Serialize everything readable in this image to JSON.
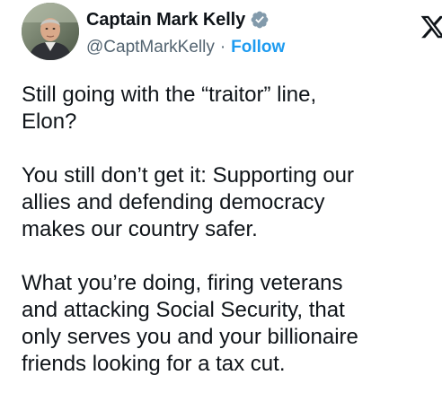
{
  "author": {
    "display_name": "Captain Mark Kelly",
    "handle": "@CaptMarkKelly",
    "separator": "·",
    "follow_label": "Follow",
    "verified": true,
    "avatar_icon": "profile-photo"
  },
  "platform": {
    "logo_icon": "x-logo-icon"
  },
  "tweet": {
    "paragraphs": [
      "Still going with the “traitor” line,\nElon?",
      "You still don’t get it: Supporting our\nallies and defending democracy\nmakes our country safer.",
      "What you’re doing, firing veterans\nand attacking Social Security, that\nonly serves you and your billionaire\nfriends looking for a tax cut."
    ]
  },
  "colors": {
    "text": "#0f1419",
    "secondary_text": "#536471",
    "link_blue": "#1d9bf0",
    "verified_gray": "#829aab",
    "background": "#ffffff"
  }
}
